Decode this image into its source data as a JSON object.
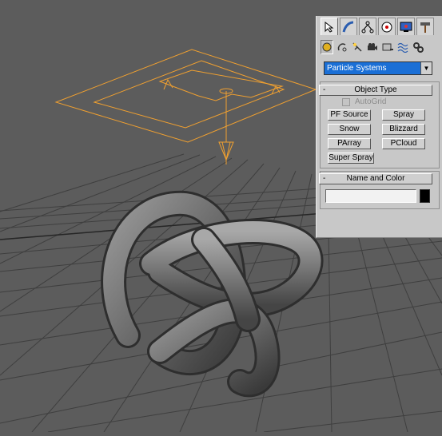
{
  "panel": {
    "tabs": [
      "create-tab",
      "modify-tab",
      "hierarchy-tab",
      "motion-tab",
      "display-tab",
      "utilities-tab"
    ],
    "subcategories": [
      "geometry",
      "shapes",
      "lights",
      "cameras",
      "helpers",
      "space-warps",
      "systems"
    ],
    "category_dropdown": {
      "value": "Particle Systems"
    },
    "object_type": {
      "title": "Object Type",
      "autogrid_label": "AutoGrid",
      "buttons": [
        "PF Source",
        "Spray",
        "Snow",
        "Blizzard",
        "PArray",
        "PCloud",
        "Super Spray"
      ]
    },
    "name_and_color": {
      "title": "Name and Color",
      "name_value": "",
      "color": "#000000"
    },
    "collapse_symbol": "-"
  },
  "colors": {
    "viewport_bg": "#5c5c5c",
    "grid_line": "#3f3f3f",
    "selection_gizmo": "#f0a030",
    "panel_bg": "#c8c8c8",
    "dropdown_highlight": "#1a6fd6"
  }
}
